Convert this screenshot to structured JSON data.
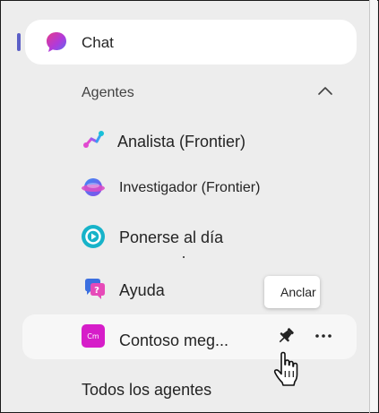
{
  "nav": {
    "chat_label": "Chat"
  },
  "agents_section": {
    "header": "Agentes",
    "items": [
      {
        "label": "Analista (Frontier)",
        "icon": "analyst-icon"
      },
      {
        "label": "Investigador (Frontier)",
        "icon": "researcher-icon"
      },
      {
        "label": "Ponerse al día",
        "icon": "catch-up-icon"
      },
      {
        "label": "Ayuda",
        "icon": "help-icon"
      },
      {
        "label": "Contoso meg...",
        "icon": "contoso-icon",
        "icon_text": "Cm"
      }
    ],
    "all_agents_label": "Todos los agentes"
  },
  "tooltip": {
    "text": "Anclar"
  },
  "colors": {
    "accent": "#5b5fc7",
    "panel_bg": "#ededed",
    "contoso": "#d61dc9"
  }
}
